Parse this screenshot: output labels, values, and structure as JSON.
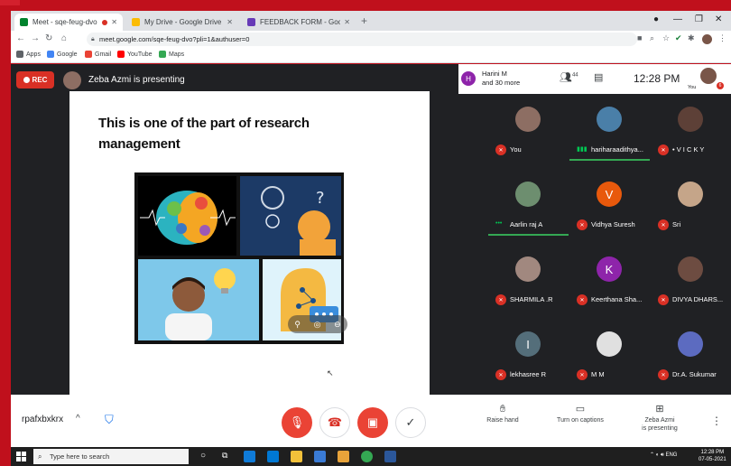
{
  "browser": {
    "tabs": [
      {
        "title": "Meet - sqe-feug-dvo",
        "active": true,
        "recording": true
      },
      {
        "title": "My Drive - Google Drive",
        "active": false
      },
      {
        "title": "FEEDBACK FORM - Google Form",
        "active": false
      }
    ],
    "new_tab": "+",
    "url": "meet.google.com/sqe-feug-dvo?pli=1&authuser=0",
    "bookmarks": [
      "Apps",
      "Google",
      "Gmail",
      "YouTube",
      "Maps"
    ]
  },
  "meet": {
    "rec_label": "REC",
    "presenting_text": "Zeba Azmi is presenting",
    "top_participant": {
      "initial": "H",
      "name": "Harini M",
      "more": "and 30 more"
    },
    "people_count": "44",
    "clock": "12:28 PM",
    "you_label": "You",
    "you_badge": "6",
    "slide": {
      "title": "This is one of the part of research management"
    },
    "participants": [
      {
        "name": "You",
        "initial": "",
        "color": "#8d6e63",
        "muted": true
      },
      {
        "name": "hariharaadithya...",
        "initial": "",
        "color": "#4a7fa8",
        "muted": false,
        "speaking": true
      },
      {
        "name": "• V I C K Y",
        "initial": "",
        "color": "#5d4037",
        "muted": true
      },
      {
        "name": "Aarlin raj A",
        "initial": "",
        "color": "#6d8e6f",
        "muted": false,
        "speaking": true
      },
      {
        "name": "Vidhya Suresh",
        "initial": "V",
        "color": "#e8590c",
        "muted": true
      },
      {
        "name": "Sri",
        "initial": "",
        "color": "#c5a589",
        "muted": true
      },
      {
        "name": "SHARMILA .R",
        "initial": "",
        "color": "#a1887f",
        "muted": true
      },
      {
        "name": "Keerthana Sha...",
        "initial": "K",
        "color": "#8e24aa",
        "muted": true
      },
      {
        "name": "DIVYA DHARS...",
        "initial": "",
        "color": "#6d4c41",
        "muted": true
      },
      {
        "name": "lekhasree R",
        "initial": "I",
        "color": "#546e7a",
        "muted": true
      },
      {
        "name": "M M",
        "initial": "",
        "color": "#e0e0e0",
        "muted": true
      },
      {
        "name": "Dr.A. Sukumar",
        "initial": "",
        "color": "#5c6bc0",
        "muted": true
      }
    ]
  },
  "controls": {
    "meeting_code": "rpafxbxkrx",
    "raise_hand": "Raise hand",
    "captions": "Turn on captions",
    "presenting_line1": "Zeba Azmi",
    "presenting_line2": "is presenting"
  },
  "taskbar": {
    "search_placeholder": "Type here to search",
    "time": "12:28 PM",
    "date": "07-05-2021",
    "lang": "ENG"
  }
}
